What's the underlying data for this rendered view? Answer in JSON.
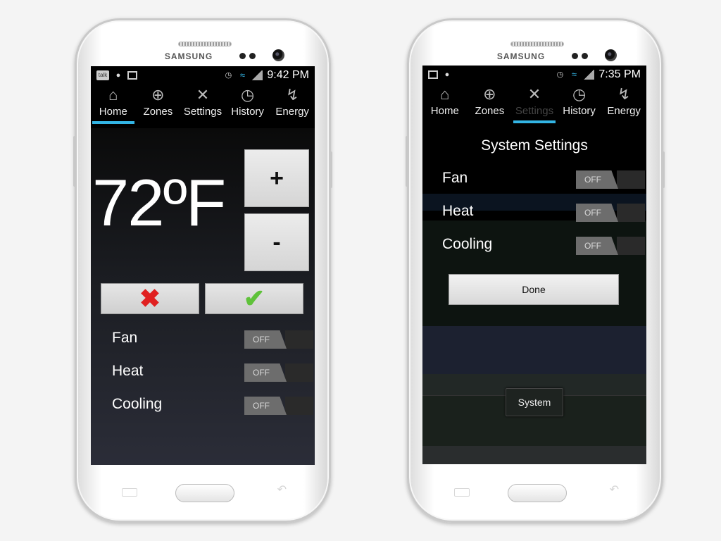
{
  "left_phone": {
    "brand": "SAMSUNG",
    "status": {
      "time": "9:42 PM",
      "talk_label": "talk"
    },
    "tabs": [
      {
        "label": "Home",
        "icon": "home-icon"
      },
      {
        "label": "Zones",
        "icon": "target-icon"
      },
      {
        "label": "Settings",
        "icon": "wrench-icon"
      },
      {
        "label": "History",
        "icon": "stopwatch-icon"
      },
      {
        "label": "Energy",
        "icon": "lightning-icon"
      }
    ],
    "active_tab": "Home",
    "temperature": "72ºF",
    "plus_label": "+",
    "minus_label": "-",
    "cancel_icon": "✖",
    "confirm_icon": "✔",
    "settings": [
      {
        "label": "Fan",
        "state": "OFF"
      },
      {
        "label": "Heat",
        "state": "OFF"
      },
      {
        "label": "Cooling",
        "state": "OFF"
      }
    ]
  },
  "right_phone": {
    "brand": "SAMSUNG",
    "status": {
      "time": "7:35 PM"
    },
    "tabs": [
      {
        "label": "Home",
        "icon": "home-icon"
      },
      {
        "label": "Zones",
        "icon": "target-icon"
      },
      {
        "label": "Settings",
        "icon": "wrench-icon"
      },
      {
        "label": "History",
        "icon": "stopwatch-icon"
      },
      {
        "label": "Energy",
        "icon": "lightning-icon"
      }
    ],
    "active_tab": "Settings",
    "dialog_title": "System Settings",
    "settings": [
      {
        "label": "Fan",
        "state": "OFF"
      },
      {
        "label": "Heat",
        "state": "OFF"
      },
      {
        "label": "Cooling",
        "state": "OFF"
      }
    ],
    "done_label": "Done",
    "system_label": "System"
  },
  "colors": {
    "accent": "#33b5e5",
    "cancel": "#e02020",
    "confirm": "#5fc23a"
  }
}
